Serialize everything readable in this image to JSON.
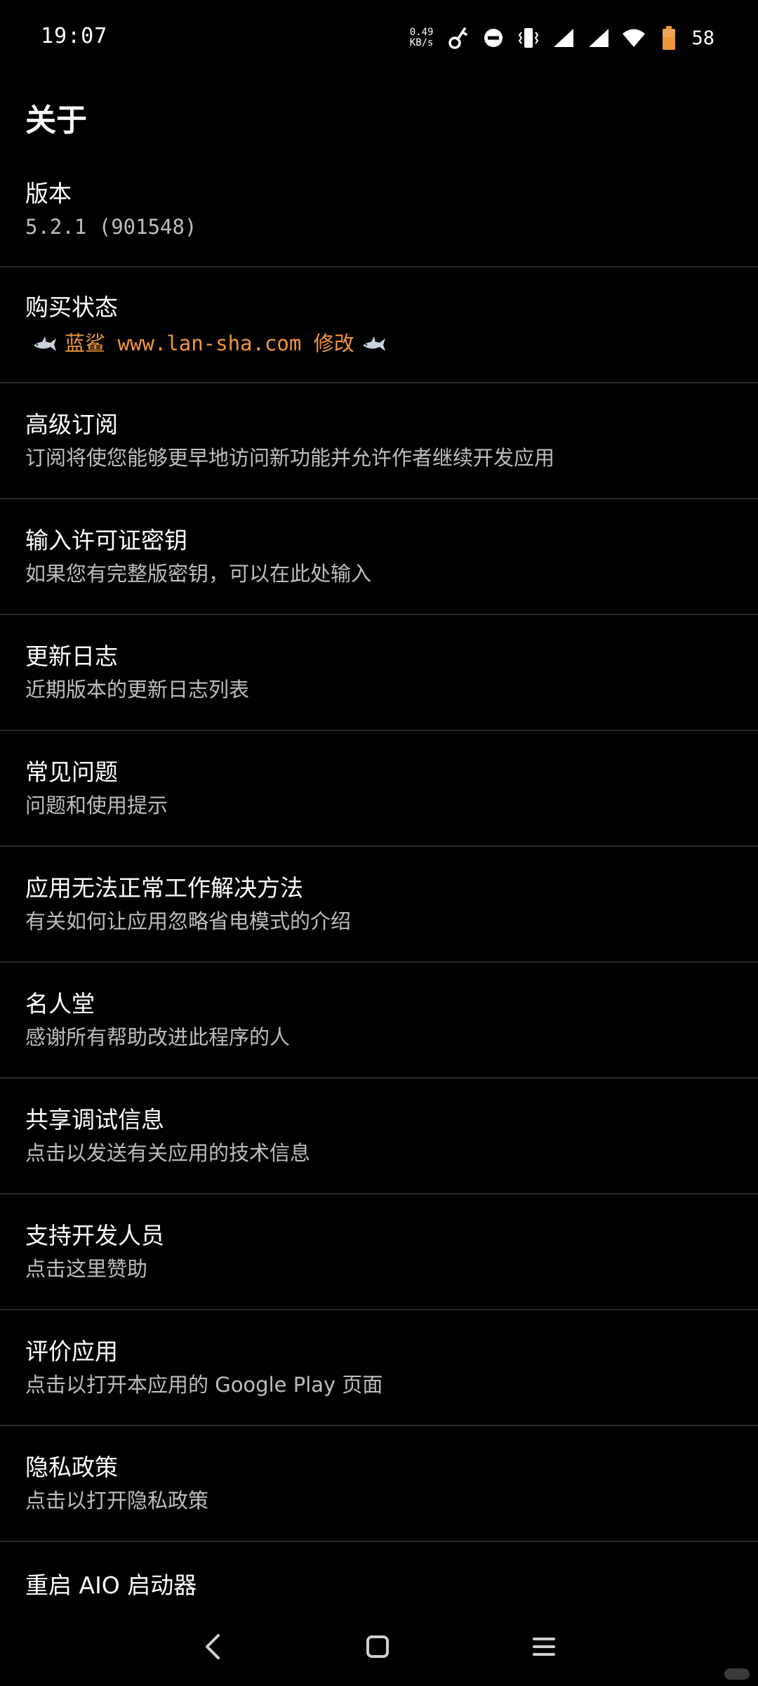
{
  "status_bar": {
    "time": "19:07",
    "net_speed_value": "0.49",
    "net_speed_unit": "KB/s",
    "battery_level": "58",
    "icons": [
      "key-icon",
      "do-not-disturb-icon",
      "vibrate-icon",
      "signal-icon",
      "signal-icon",
      "wifi-icon",
      "battery-icon"
    ],
    "battery_color": "#f0953a"
  },
  "page": {
    "title": "关于"
  },
  "settings": {
    "items": [
      {
        "title": "版本",
        "subtitle": "5.2.1 (901548)"
      },
      {
        "title": "购买状态",
        "subtitle": "蓝鲨 www.lan-sha.com 修改"
      },
      {
        "title": "高级订阅",
        "subtitle": "订阅将使您能够更早地访问新功能并允许作者继续开发应用"
      },
      {
        "title": "输入许可证密钥",
        "subtitle": "如果您有完整版密钥，可以在此处输入"
      },
      {
        "title": "更新日志",
        "subtitle": "近期版本的更新日志列表"
      },
      {
        "title": "常见问题",
        "subtitle": "问题和使用提示"
      },
      {
        "title": "应用无法正常工作解决方法",
        "subtitle": "有关如何让应用忽略省电模式的介绍"
      },
      {
        "title": "名人堂",
        "subtitle": "感谢所有帮助改进此程序的人"
      },
      {
        "title": "共享调试信息",
        "subtitle": "点击以发送有关应用的技术信息"
      },
      {
        "title": "支持开发人员",
        "subtitle": "点击这里赞助"
      },
      {
        "title": "评价应用",
        "subtitle": "点击以打开本应用的 Google Play 页面"
      },
      {
        "title": "隐私政策",
        "subtitle": "点击以打开隐私政策"
      },
      {
        "title": "重启 AIO 启动器"
      }
    ]
  },
  "accent_color": "#f0953a",
  "nav_bar": {
    "icons": [
      "back-icon",
      "home-icon",
      "menu-icon"
    ]
  }
}
